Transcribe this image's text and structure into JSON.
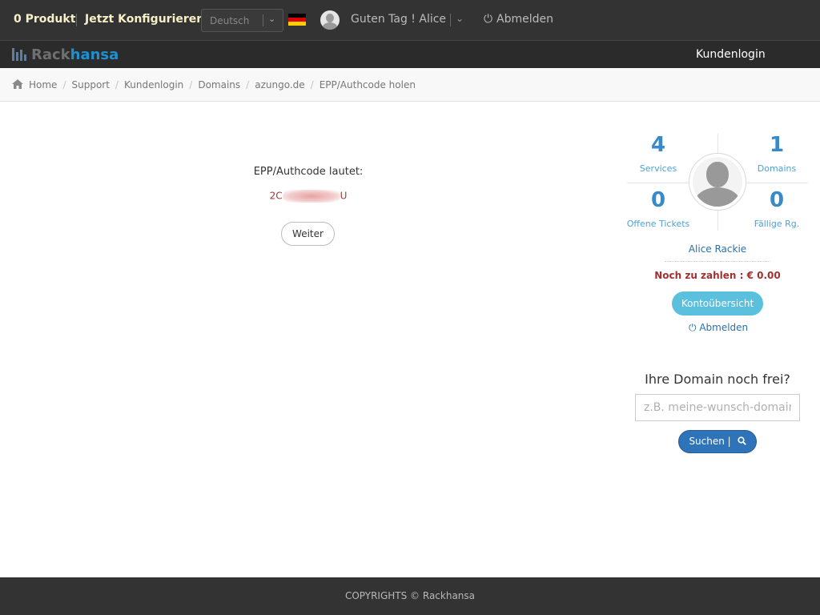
{
  "topbar": {
    "cart_label": "0 Produkt",
    "configure_label": "Jetzt Konfigurieren",
    "language": {
      "selected": "Deutsch"
    },
    "greeting": "Guten Tag ! Alice",
    "logout_label": "Abmelden"
  },
  "navbar": {
    "logo": {
      "part1": "Rack",
      "part2": "hansa"
    },
    "kundenlogin_label": "Kundenlogin"
  },
  "breadcrumb": {
    "items": [
      "Home",
      "Support",
      "Kundenlogin",
      "Domains",
      "azungo.de",
      "EPP/Authcode holen"
    ]
  },
  "main": {
    "epp_label": "EPP/Authcode lautet:",
    "epp_code_start": "2C",
    "epp_code_end": "U",
    "continue_label": "Weiter"
  },
  "sidebar": {
    "stats": {
      "services": {
        "value": "4",
        "label": "Services"
      },
      "domains": {
        "value": "1",
        "label": "Domains"
      },
      "tickets": {
        "value": "0",
        "label": "Offene Tickets"
      },
      "invoices": {
        "value": "0",
        "label": "Fällige Rg."
      }
    },
    "user_name": "Alice Rackie",
    "balance": "Noch zu zahlen : € 0.00",
    "account_button": "Kontoübersicht",
    "logout_label": "Abmelden"
  },
  "domain_search": {
    "title": "Ihre Domain noch frei?",
    "placeholder": "z.B. meine-wunsch-domain.de",
    "button_label": "Suchen  |"
  },
  "footer": {
    "copyright": "COPYRIGHTS © Rackhansa"
  },
  "colors": {
    "topbar_bg": "#333333",
    "accent_blue": "#3a8ac8",
    "button_cyan": "#5bc0de",
    "button_blue": "#2f73b8",
    "balance_red": "#a13030"
  }
}
